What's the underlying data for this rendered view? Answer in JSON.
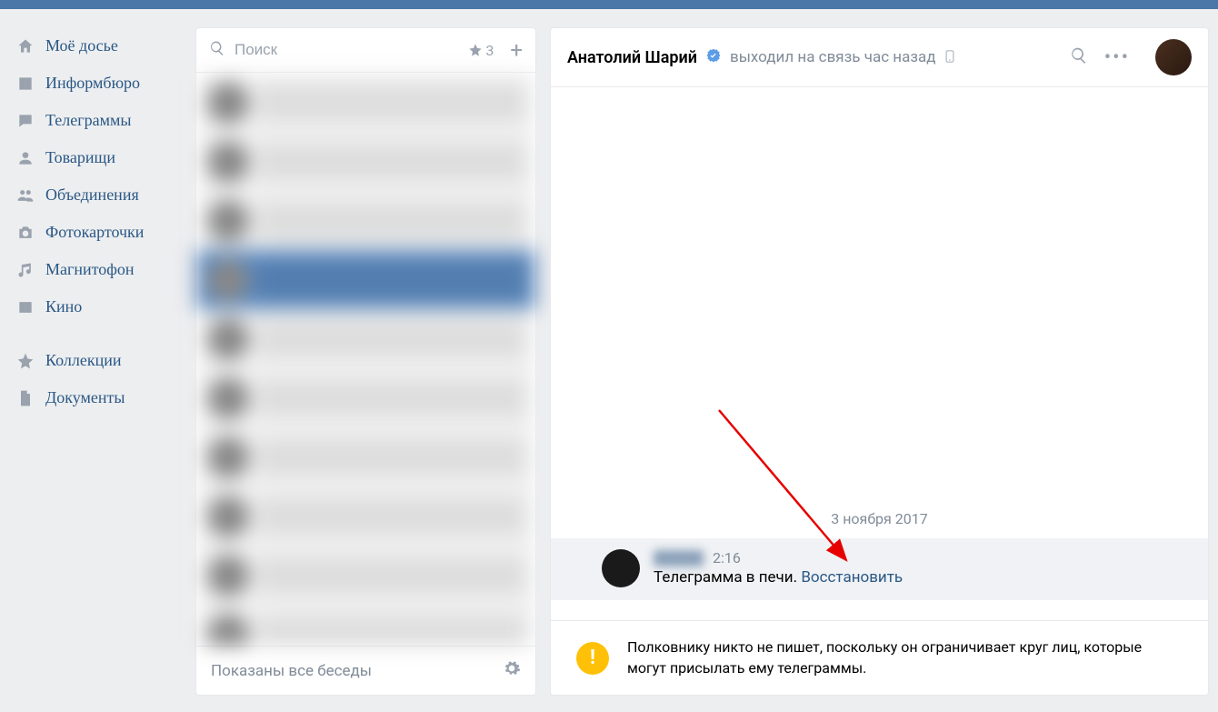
{
  "sidebar": {
    "items": [
      {
        "icon": "home",
        "label": "Моё досье"
      },
      {
        "icon": "news",
        "label": "Информбюро"
      },
      {
        "icon": "messages",
        "label": "Телеграммы"
      },
      {
        "icon": "friends",
        "label": "Товарищи"
      },
      {
        "icon": "groups",
        "label": "Объединения"
      },
      {
        "icon": "photos",
        "label": "Фотокарточки"
      },
      {
        "icon": "music",
        "label": "Магнитофон"
      },
      {
        "icon": "video",
        "label": "Кино"
      }
    ],
    "items2": [
      {
        "icon": "star",
        "label": "Коллекции"
      },
      {
        "icon": "docs",
        "label": "Документы"
      }
    ]
  },
  "conversations": {
    "search_placeholder": "Поиск",
    "star_count": "3",
    "footer": "Показаны все беседы"
  },
  "chat": {
    "title": "Анатолий Шарий",
    "status": "выходил на связь час назад",
    "date_separator": "3 ноября 2017",
    "message": {
      "time": "2:16",
      "text_deleted": "Телеграмма в печи.",
      "restore_link": "Восстановить"
    },
    "notice": "Полковнику никто не пишет, поскольку он ограничивает круг лиц, которые могут присылать ему телеграммы."
  }
}
